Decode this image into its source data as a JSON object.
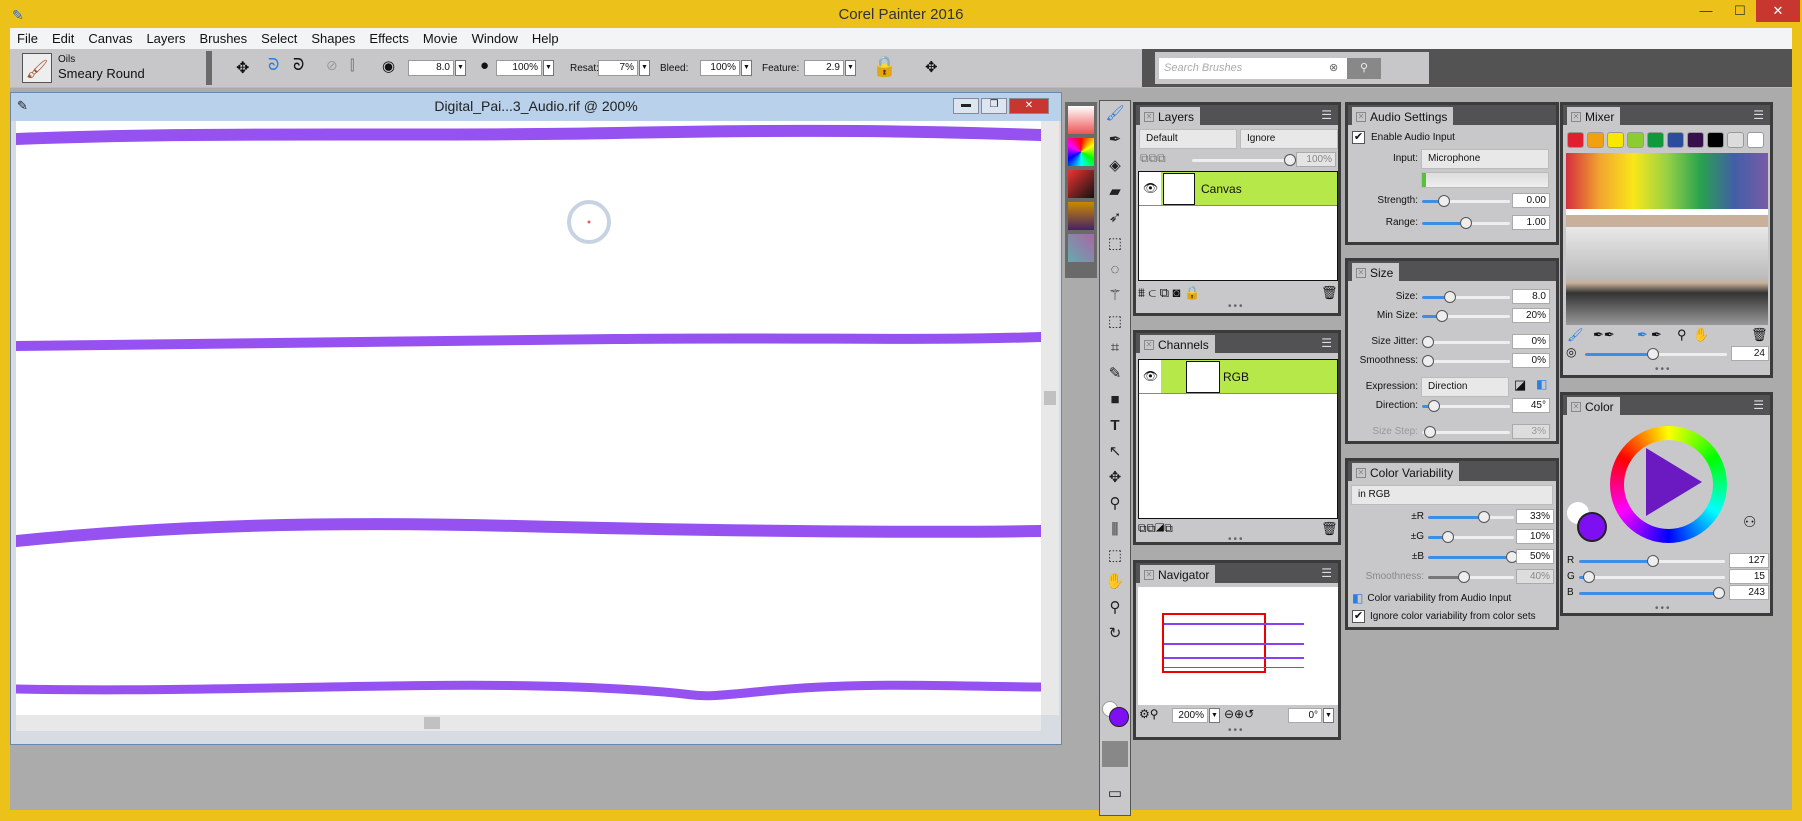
{
  "app": {
    "title": "Corel Painter 2016",
    "window_controls": {
      "minimize": "—",
      "maximize": "☐",
      "close": "✕"
    }
  },
  "menu": [
    "File",
    "Edit",
    "Canvas",
    "Layers",
    "Brushes",
    "Select",
    "Shapes",
    "Effects",
    "Movie",
    "Window",
    "Help"
  ],
  "toolbar": {
    "brush_category": "Oils",
    "brush_variant": "Smeary Round",
    "size": "8.0",
    "opacity": "100%",
    "resat_label": "Resat:",
    "resat": "7%",
    "bleed_label": "Bleed:",
    "bleed": "100%",
    "feature_label": "Feature:",
    "feature": "2.9",
    "search_placeholder": "Search Brushes"
  },
  "document": {
    "title": "Digital_Pai...3_Audio.rif @ 200%",
    "stroke_color": "#8a3ff0"
  },
  "layers": {
    "title": "Layers",
    "composite_method": "Default",
    "composite_depth": "Ignore",
    "opacity": "100%",
    "items": [
      {
        "name": "Canvas",
        "selected": true
      }
    ]
  },
  "channels": {
    "title": "Channels",
    "items": [
      {
        "name": "RGB"
      }
    ]
  },
  "navigator": {
    "title": "Navigator",
    "zoom": "200%",
    "rotation": "0°"
  },
  "audio": {
    "title": "Audio Settings",
    "enable_label": "Enable Audio Input",
    "enabled": true,
    "input_label": "Input:",
    "input": "Microphone",
    "strength_label": "Strength:",
    "strength": "0.00",
    "strength_frac": 0.25,
    "range_label": "Range:",
    "range": "1.00",
    "range_frac": 0.5
  },
  "size": {
    "title": "Size",
    "rows": [
      {
        "label": "Size:",
        "value": "8.0",
        "frac": 0.33
      },
      {
        "label": "Min Size:",
        "value": "20%",
        "frac": 0.2
      },
      {
        "label": "Size Jitter:",
        "value": "0%",
        "frac": 0
      },
      {
        "label": "Smoothness:",
        "value": "0%",
        "frac": 0
      },
      {
        "label": "Direction:",
        "value": "45°",
        "frac": 0.12
      },
      {
        "label": "Size Step:",
        "value": "3%",
        "frac": 0.03
      }
    ],
    "expression_label": "Expression:",
    "expression": "Direction"
  },
  "color_variability": {
    "title": "Color Variability",
    "mode": "in RGB",
    "rows": [
      {
        "label": "±R",
        "value": "33%",
        "frac": 0.63
      },
      {
        "label": "±G",
        "value": "10%",
        "frac": 0.2
      },
      {
        "label": "±B",
        "value": "50%",
        "frac": 0.97
      },
      {
        "label": "Smoothness:",
        "value": "40%",
        "frac": 0.4
      }
    ],
    "audio_label": "Color variability from Audio Input",
    "ignore_label": "Ignore color variability from color sets",
    "ignore_checked": true
  },
  "mixer": {
    "title": "Mixer",
    "swatches": [
      "#e0202e",
      "#f0a010",
      "#f8e800",
      "#8ccc30",
      "#10983c",
      "#2c4c9c",
      "#38104c",
      "#000000",
      "#dcdcdc",
      "#ffffff"
    ],
    "brush_size": "24",
    "brush_frac": 0.48
  },
  "color": {
    "title": "Color",
    "primary": "#7f0ff3",
    "secondary": "#ffffff",
    "rows": [
      {
        "label": "R",
        "value": "127",
        "frac": 0.5
      },
      {
        "label": "G",
        "value": "15",
        "frac": 0.06
      },
      {
        "label": "B",
        "value": "243",
        "frac": 0.95
      }
    ]
  }
}
